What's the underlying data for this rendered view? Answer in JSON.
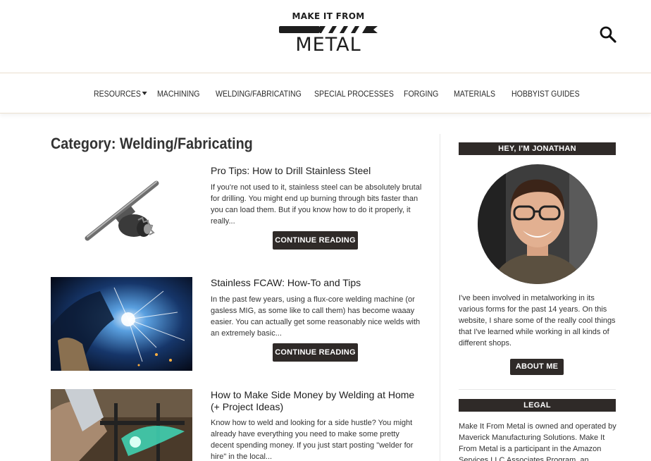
{
  "header": {
    "logo_top": "MAKE IT FROM",
    "logo_bottom": "METAL",
    "search_icon": "search-icon"
  },
  "nav": {
    "items": [
      {
        "label": "RESOURCES",
        "has_dropdown": true
      },
      {
        "label": "MACHINING"
      },
      {
        "label": "WELDING/FABRICATING"
      },
      {
        "label": "SPECIAL PROCESSES"
      },
      {
        "label": "FORGING"
      },
      {
        "label": "MATERIALS"
      },
      {
        "label": "HOBBYIST GUIDES"
      }
    ]
  },
  "main": {
    "title": "Category: Welding/Fabricating",
    "posts": [
      {
        "title": "Pro Tips: How to Drill Stainless Steel",
        "excerpt": "If you're not used to it, stainless steel can be absolutely brutal for drilling. You might end up burning through bits faster than you can load them. But if you know how to do it properly, it really...",
        "button": "CONTINUE READING",
        "image": "drill-chuck-key"
      },
      {
        "title": "Stainless FCAW: How-To and Tips",
        "excerpt": "In the past few years, using a flux-core welding machine (or gasless MIG, as some like to call them) has become waaay easier. You can actually get some reasonably nice welds with an extremely basic...",
        "button": "CONTINUE READING",
        "image": "welder-sparks"
      },
      {
        "title": "How to Make Side Money by Welding at Home (+ Project Ideas)",
        "excerpt": "Know how to weld and looking for a side hustle? You might already have everything you need to make some pretty decent spending money. If you just start posting \"welder for hire\" in the local...",
        "image": "welding-at-home"
      }
    ]
  },
  "sidebar": {
    "about_heading": "HEY, I'M JONATHAN",
    "about_text": "I've been involved in metalworking in its various forms for the past 14 years. On this website, I share some of the really cool things that I've learned while working in all kinds of different shops.",
    "about_button": "ABOUT ME",
    "legal_heading": "LEGAL",
    "legal_text": "Make It From Metal is owned and operated by Maverick Manufacturing Solutions. Make It From Metal is a participant in the Amazon Services LLC Associates Program, an"
  },
  "colors": {
    "dark_button": "#2f2a28",
    "nav_border": "#eadfcf",
    "text": "#2b2b2b"
  }
}
